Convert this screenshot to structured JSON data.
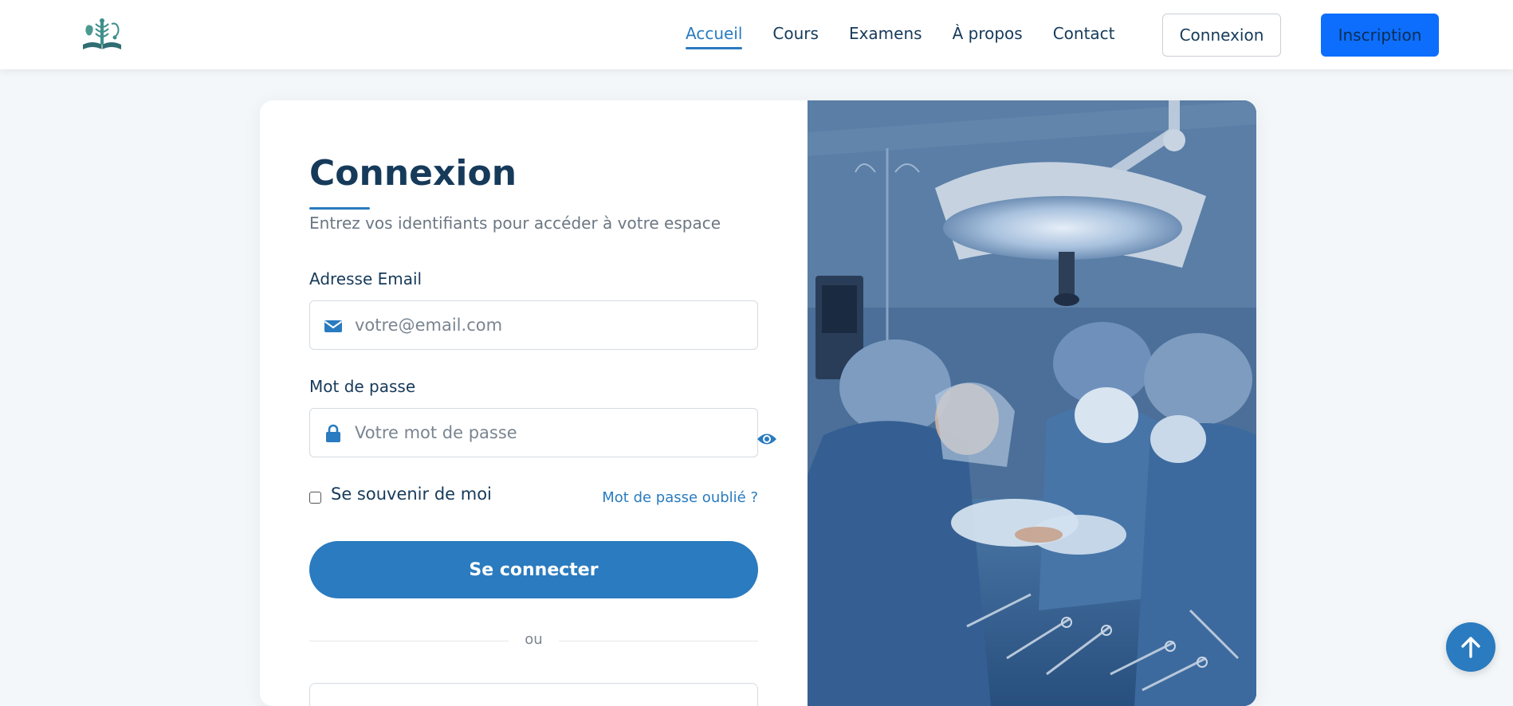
{
  "nav": {
    "links": [
      "Accueil",
      "Cours",
      "Examens",
      "À propos",
      "Contact"
    ],
    "active_index": 0,
    "login_label": "Connexion",
    "signup_label": "Inscription"
  },
  "login": {
    "title": "Connexion",
    "subtitle": "Entrez vos identifiants pour accéder à votre espace",
    "email_label": "Adresse Email",
    "email_placeholder": "votre@email.com",
    "password_label": "Mot de passe",
    "password_placeholder": "Votre mot de passe",
    "remember_label": "Se souvenir de moi",
    "remember_checked": false,
    "forgot_label": "Mot de passe oublié ?",
    "submit_label": "Se connecter",
    "divider_text": "ou"
  },
  "colors": {
    "primary": "#2a7bbf",
    "navy": "#163a5a",
    "signup_bg": "#0d6efd"
  },
  "icons": [
    "logo-icon",
    "envelope-icon",
    "lock-icon",
    "eye-icon",
    "arrow-up-icon"
  ]
}
